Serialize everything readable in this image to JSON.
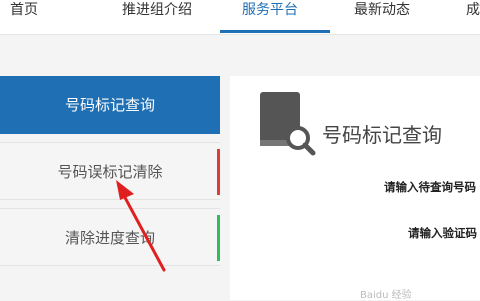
{
  "nav": {
    "items": [
      {
        "label": "首页"
      },
      {
        "label": "推进组介绍"
      },
      {
        "label": "服务平台",
        "active": true
      },
      {
        "label": "最新动态"
      },
      {
        "label": "成"
      }
    ]
  },
  "sidebar": {
    "items": [
      {
        "label": "号码标记查询",
        "active": true
      },
      {
        "label": "号码误标记清除",
        "accent": "#e03b3b"
      },
      {
        "label": "清除进度查询",
        "accent": "#2ebd5a"
      }
    ]
  },
  "content": {
    "title": "号码标记查询",
    "icon": "book-search-icon",
    "fields": [
      {
        "label": "请输入待查询号码"
      },
      {
        "label": "请输入验证码"
      }
    ]
  },
  "annotation": {
    "icon": "red-arrow-icon",
    "color": "#e02020"
  },
  "watermark": {
    "text": "Baidu 经验"
  },
  "colors": {
    "brand": "#1f6fb5"
  }
}
